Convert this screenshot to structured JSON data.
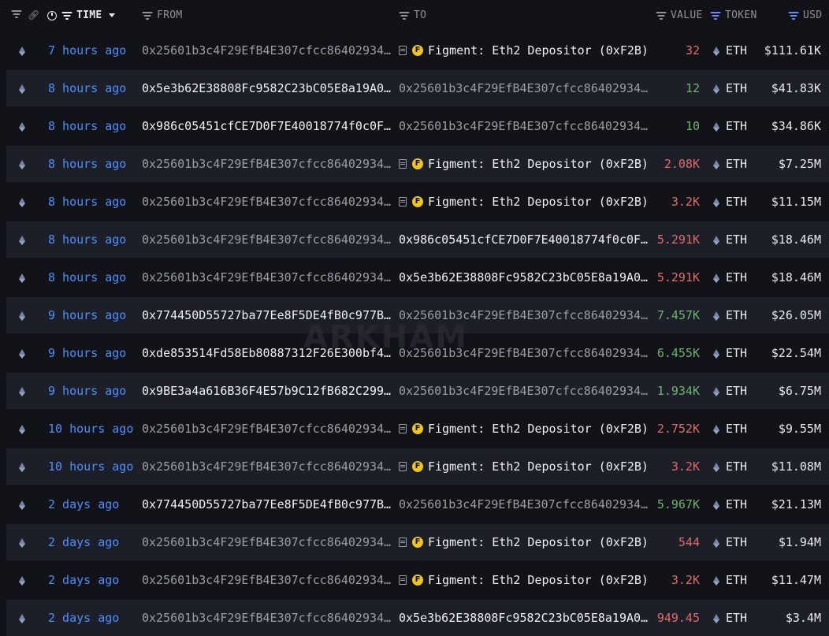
{
  "header": {
    "time": "TIME",
    "from": "FROM",
    "to": "TO",
    "value": "VALUE",
    "token": "TOKEN",
    "usd": "USD"
  },
  "watermark": "ARKHAM",
  "rows": [
    {
      "time": "7 hours ago",
      "from": "0x25601b3c4F29EfB4E307cfcc86402934…",
      "from_style": "dim",
      "to_type": "entity",
      "to": "Figment: Eth2 Depositor (0xF2B)",
      "value": "32",
      "value_color": "red",
      "token": "ETH",
      "usd": "$111.61K"
    },
    {
      "time": "8 hours ago",
      "from": "0x5e3b62E38808Fc9582C23bC05E8a19A0…",
      "from_style": "bright",
      "to_type": "addr",
      "to": "0x25601b3c4F29EfB4E307cfcc86402934…",
      "to_style": "dim",
      "value": "12",
      "value_color": "green",
      "token": "ETH",
      "usd": "$41.83K"
    },
    {
      "time": "8 hours ago",
      "from": "0x986c05451cfCE7D0F7E40018774f0c0F…",
      "from_style": "bright",
      "to_type": "addr",
      "to": "0x25601b3c4F29EfB4E307cfcc86402934…",
      "to_style": "dim",
      "value": "10",
      "value_color": "green",
      "token": "ETH",
      "usd": "$34.86K"
    },
    {
      "time": "8 hours ago",
      "from": "0x25601b3c4F29EfB4E307cfcc86402934…",
      "from_style": "dim",
      "to_type": "entity",
      "to": "Figment: Eth2 Depositor (0xF2B)",
      "value": "2.08K",
      "value_color": "red",
      "token": "ETH",
      "usd": "$7.25M"
    },
    {
      "time": "8 hours ago",
      "from": "0x25601b3c4F29EfB4E307cfcc86402934…",
      "from_style": "dim",
      "to_type": "entity",
      "to": "Figment: Eth2 Depositor (0xF2B)",
      "value": "3.2K",
      "value_color": "red",
      "token": "ETH",
      "usd": "$11.15M"
    },
    {
      "time": "8 hours ago",
      "from": "0x25601b3c4F29EfB4E307cfcc86402934…",
      "from_style": "dim",
      "to_type": "addr",
      "to": "0x986c05451cfCE7D0F7E40018774f0c0F…",
      "to_style": "bright",
      "value": "5.291K",
      "value_color": "red",
      "token": "ETH",
      "usd": "$18.46M"
    },
    {
      "time": "8 hours ago",
      "from": "0x25601b3c4F29EfB4E307cfcc86402934…",
      "from_style": "dim",
      "to_type": "addr",
      "to": "0x5e3b62E38808Fc9582C23bC05E8a19A0…",
      "to_style": "bright",
      "value": "5.291K",
      "value_color": "red",
      "token": "ETH",
      "usd": "$18.46M"
    },
    {
      "time": "9 hours ago",
      "from": "0x774450D55727ba77Ee8F5DE4fB0c977B…",
      "from_style": "bright",
      "to_type": "addr",
      "to": "0x25601b3c4F29EfB4E307cfcc86402934…",
      "to_style": "dim",
      "value": "7.457K",
      "value_color": "green",
      "token": "ETH",
      "usd": "$26.05M"
    },
    {
      "time": "9 hours ago",
      "from": "0xde853514Fd58Eb80887312F26E300bf4…",
      "from_style": "bright",
      "to_type": "addr",
      "to": "0x25601b3c4F29EfB4E307cfcc86402934…",
      "to_style": "dim",
      "value": "6.455K",
      "value_color": "green",
      "token": "ETH",
      "usd": "$22.54M"
    },
    {
      "time": "9 hours ago",
      "from": "0x9BE3a4a616B36F4E57b9C12fB682C299…",
      "from_style": "bright",
      "to_type": "addr",
      "to": "0x25601b3c4F29EfB4E307cfcc86402934…",
      "to_style": "dim",
      "value": "1.934K",
      "value_color": "green",
      "token": "ETH",
      "usd": "$6.75M"
    },
    {
      "time": "10 hours ago",
      "from": "0x25601b3c4F29EfB4E307cfcc86402934…",
      "from_style": "dim",
      "to_type": "entity",
      "to": "Figment: Eth2 Depositor (0xF2B)",
      "value": "2.752K",
      "value_color": "red",
      "token": "ETH",
      "usd": "$9.55M"
    },
    {
      "time": "10 hours ago",
      "from": "0x25601b3c4F29EfB4E307cfcc86402934…",
      "from_style": "dim",
      "to_type": "entity",
      "to": "Figment: Eth2 Depositor (0xF2B)",
      "value": "3.2K",
      "value_color": "red",
      "token": "ETH",
      "usd": "$11.08M"
    },
    {
      "time": "2 days ago",
      "from": "0x774450D55727ba77Ee8F5DE4fB0c977B…",
      "from_style": "bright",
      "to_type": "addr",
      "to": "0x25601b3c4F29EfB4E307cfcc86402934…",
      "to_style": "dim",
      "value": "5.967K",
      "value_color": "green",
      "token": "ETH",
      "usd": "$21.13M"
    },
    {
      "time": "2 days ago",
      "from": "0x25601b3c4F29EfB4E307cfcc86402934…",
      "from_style": "dim",
      "to_type": "entity",
      "to": "Figment: Eth2 Depositor (0xF2B)",
      "value": "544",
      "value_color": "red",
      "token": "ETH",
      "usd": "$1.94M"
    },
    {
      "time": "2 days ago",
      "from": "0x25601b3c4F29EfB4E307cfcc86402934…",
      "from_style": "dim",
      "to_type": "entity",
      "to": "Figment: Eth2 Depositor (0xF2B)",
      "value": "3.2K",
      "value_color": "red",
      "token": "ETH",
      "usd": "$11.47M"
    },
    {
      "time": "2 days ago",
      "from": "0x25601b3c4F29EfB4E307cfcc86402934…",
      "from_style": "dim",
      "to_type": "addr",
      "to": "0x5e3b62E38808Fc9582C23bC05E8a19A0…",
      "to_style": "bright",
      "value": "949.45",
      "value_color": "red",
      "token": "ETH",
      "usd": "$3.4M"
    }
  ],
  "colors": {
    "background": "#111318",
    "row_alt": "#1c1f27",
    "time_link": "#4f8eff",
    "value_out": "#e26a6a",
    "value_in": "#6fb36f"
  },
  "icons": {
    "chain": "ethereum-icon",
    "token": "ethereum-icon",
    "entity_logo": "figment-logo-icon",
    "contract": "contract-doc-icon"
  }
}
